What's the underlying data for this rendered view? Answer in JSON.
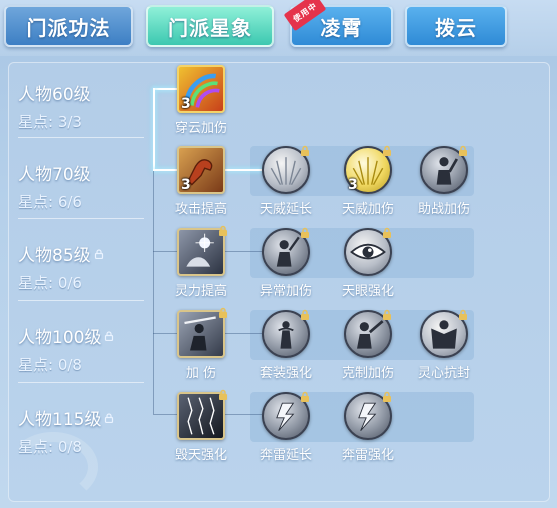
{
  "tabs": [
    {
      "label": "门派功法",
      "state": "inactive"
    },
    {
      "label": "门派星象",
      "state": "active"
    },
    {
      "label": "凌霄",
      "state": "inactive",
      "badge": "使用中"
    },
    {
      "label": "拨云",
      "state": "inactive"
    }
  ],
  "levels": [
    {
      "name": "人物60级",
      "points": "星点: 3/3",
      "locked": false
    },
    {
      "name": "人物70级",
      "points": "星点: 6/6",
      "locked": false
    },
    {
      "name": "人物85级",
      "points": "星点: 0/6",
      "locked": true
    },
    {
      "name": "人物100级",
      "points": "星点: 0/8",
      "locked": true
    },
    {
      "name": "人物115级",
      "points": "星点: 0/8",
      "locked": true
    }
  ],
  "skills": {
    "row1": [
      {
        "name": "穿云加伤",
        "count": "3",
        "icon": "rainbow-swirl-icon",
        "locked": false
      }
    ],
    "row2": [
      {
        "name": "攻击提高",
        "count": "3",
        "icon": "flexed-arm-icon",
        "locked": false
      },
      {
        "name": "天威延长",
        "count": "",
        "icon": "radiant-light-icon",
        "locked": true
      },
      {
        "name": "天威加伤",
        "count": "3",
        "icon": "golden-light-icon",
        "locked": true
      },
      {
        "name": "助战加伤",
        "count": "",
        "icon": "warrior-silhouette-icon",
        "locked": true
      }
    ],
    "row3": [
      {
        "name": "灵力提高",
        "count": "",
        "icon": "energy-hand-icon",
        "locked": true
      },
      {
        "name": "异常加伤",
        "count": "",
        "icon": "swordsman-icon",
        "locked": true
      },
      {
        "name": "天眼强化",
        "count": "",
        "icon": "eye-icon",
        "locked": true
      }
    ],
    "row4": [
      {
        "name": "加 伤",
        "count": "",
        "icon": "sword-strike-icon",
        "locked": true
      },
      {
        "name": "套装强化",
        "count": "",
        "icon": "armored-figure-icon",
        "locked": true
      },
      {
        "name": "克制加伤",
        "count": "",
        "icon": "blade-warrior-icon",
        "locked": true
      },
      {
        "name": "灵心抗封",
        "count": "",
        "icon": "shielded-figure-icon",
        "locked": true
      }
    ],
    "row5": [
      {
        "name": "毁天强化",
        "count": "",
        "icon": "lightning-storm-icon",
        "locked": true
      },
      {
        "name": "奔雷延长",
        "count": "",
        "icon": "lightning-bolt-icon",
        "locked": true
      },
      {
        "name": "奔雷强化",
        "count": "",
        "icon": "lightning-bolt-icon",
        "locked": true
      }
    ]
  },
  "colors": {
    "active_tab": "#3cc8b0",
    "inactive_tab": "#3d7fc4",
    "badge": "#e5334b",
    "lock": "#e8c15a"
  }
}
